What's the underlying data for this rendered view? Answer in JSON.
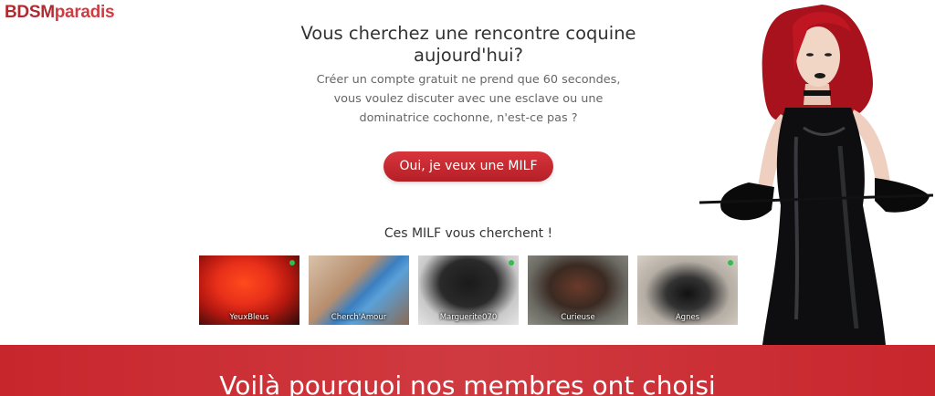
{
  "logo": {
    "part1": "BDSM",
    "part2": "paradis"
  },
  "headline": "Vous cherchez une rencontre coquine aujourd'hui?",
  "subtext": "Créer un compte gratuit ne prend que 60 secondes, vous voulez discuter avec une esclave ou une dominatrice cochonne, n'est-ce pas ?",
  "cta_label": "Oui, je veux une MILF",
  "profiles_title": "Ces MILF vous cherchent !",
  "profiles": [
    {
      "name": "YeuxBleus",
      "online": true
    },
    {
      "name": "Cherch'Amour",
      "online": false
    },
    {
      "name": "Marguerite070",
      "online": true
    },
    {
      "name": "Curieuse",
      "online": false
    },
    {
      "name": "Agnes",
      "online": true
    }
  ],
  "band_title": "Voilà pourquoi nos membres ont choisi",
  "colors": {
    "brand_red": "#c8262d",
    "online_dot": "#2fbf4a"
  },
  "icons": {
    "online_indicator": "online-dot-icon"
  }
}
